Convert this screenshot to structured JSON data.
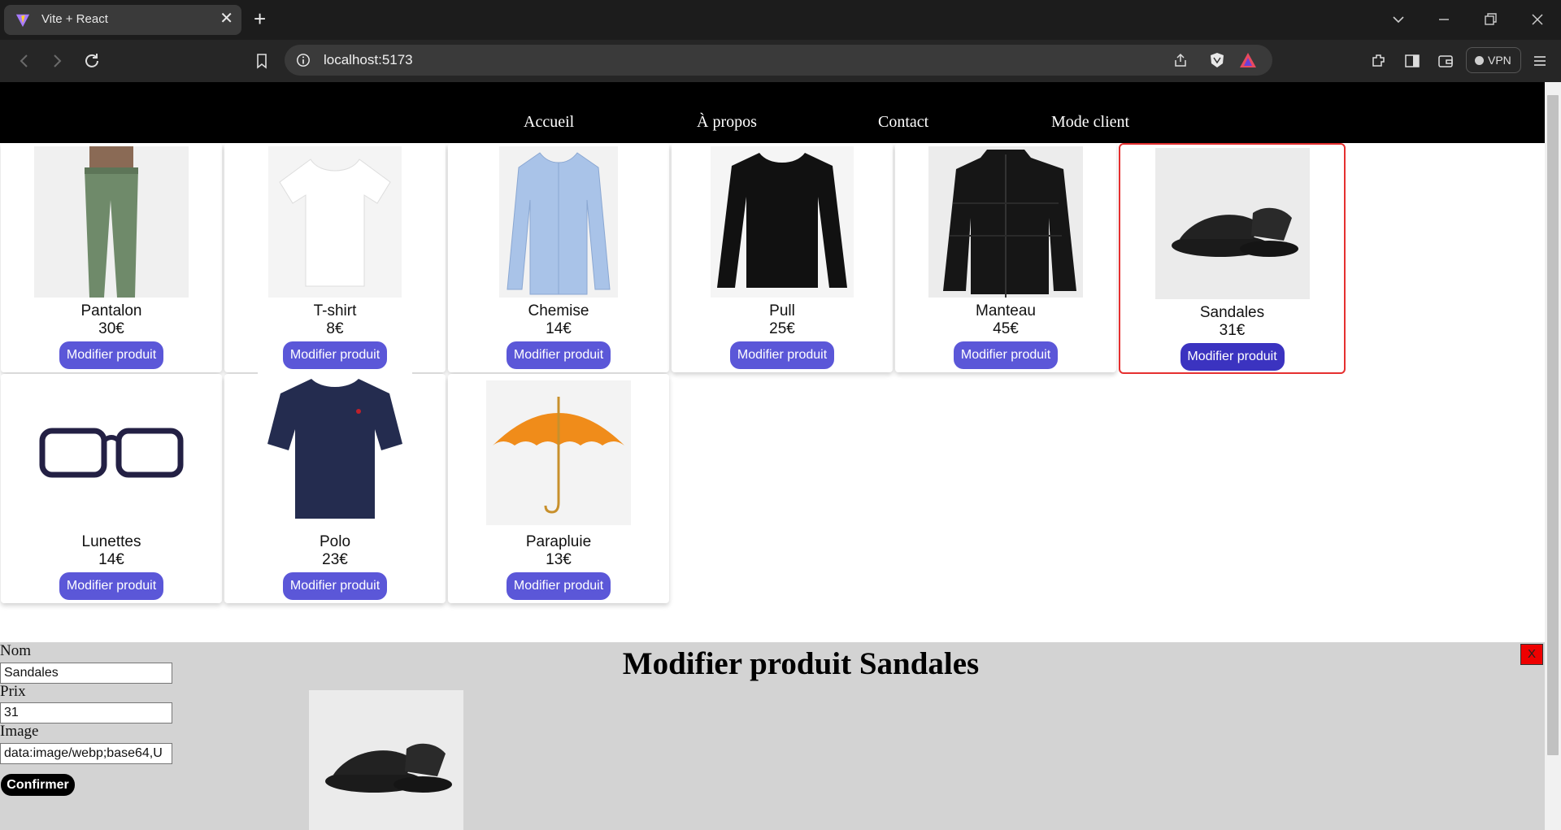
{
  "browser": {
    "tab_title": "Vite + React",
    "tab_close": "✕",
    "new_tab": "+",
    "url": "localhost:5173",
    "vpn_label": "VPN"
  },
  "nav": {
    "links": [
      "Accueil",
      "À propos",
      "Contact",
      "Mode client"
    ]
  },
  "products": [
    {
      "name": "Pantalon",
      "price": "30€",
      "button": "Modifier produit",
      "icon": "trousers-image"
    },
    {
      "name": "T-shirt",
      "price": "8€",
      "button": "Modifier produit",
      "icon": "tshirt-image"
    },
    {
      "name": "Chemise",
      "price": "14€",
      "button": "Modifier produit",
      "icon": "shirt-image"
    },
    {
      "name": "Pull",
      "price": "25€",
      "button": "Modifier produit",
      "icon": "sweater-image"
    },
    {
      "name": "Manteau",
      "price": "45€",
      "button": "Modifier produit",
      "icon": "coat-image"
    },
    {
      "name": "Sandales",
      "price": "31€",
      "button": "Modifier produit",
      "icon": "sandals-image",
      "selected": true
    },
    {
      "name": "Lunettes",
      "price": "14€",
      "button": "Modifier produit",
      "icon": "glasses-image"
    },
    {
      "name": "Polo",
      "price": "23€",
      "button": "Modifier produit",
      "icon": "polo-image"
    },
    {
      "name": "Parapluie",
      "price": "13€",
      "button": "Modifier produit",
      "icon": "umbrella-image"
    }
  ],
  "edit_form": {
    "title": "Modifier produit Sandales",
    "close_label": "X",
    "name_label": "Nom",
    "name_value": "Sandales",
    "price_label": "Prix",
    "price_value": "31",
    "image_label": "Image",
    "image_value": "data:image/webp;base64,U",
    "confirm_label": "Confirmer"
  },
  "colors": {
    "button": "#5b57d8",
    "selected_border": "#e53030",
    "navbar": "#000000",
    "panel": "#d3d3d3"
  }
}
